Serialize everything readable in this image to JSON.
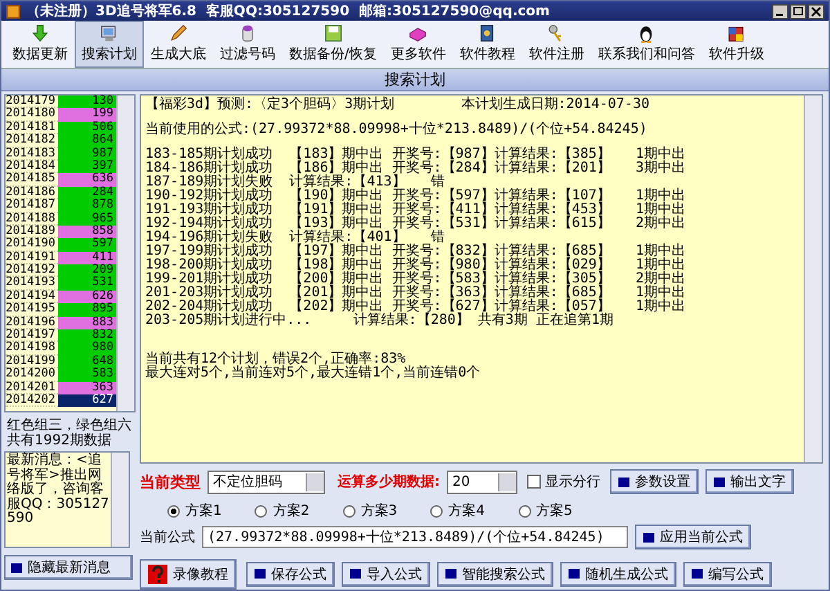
{
  "window": {
    "title": "（未注册）3D追号将军6.8  客服QQ:305127590  邮箱:305127590@qq.com"
  },
  "toolbar": [
    {
      "label": "数据更新",
      "selected": false
    },
    {
      "label": "搜索计划",
      "selected": true
    },
    {
      "label": "生成大底",
      "selected": false
    },
    {
      "label": "过滤号码",
      "selected": false
    },
    {
      "label": "数据备份/恢复",
      "selected": false
    },
    {
      "label": "更多软件",
      "selected": false
    },
    {
      "label": "软件教程",
      "selected": false
    },
    {
      "label": "软件注册",
      "selected": false
    },
    {
      "label": "联系我们和问答",
      "selected": false
    },
    {
      "label": "软件升级",
      "selected": false
    }
  ],
  "panel_title": "搜索计划",
  "history": [
    {
      "period": "2014179",
      "number": "130",
      "color": "#00cc00",
      "selected": false
    },
    {
      "period": "2014180",
      "number": "199",
      "color": "#e070e0",
      "selected": false
    },
    {
      "period": "2014181",
      "number": "506",
      "color": "#00cc00",
      "selected": false
    },
    {
      "period": "2014182",
      "number": "864",
      "color": "#00cc00",
      "selected": false
    },
    {
      "period": "2014183",
      "number": "987",
      "color": "#00cc00",
      "selected": false
    },
    {
      "period": "2014184",
      "number": "397",
      "color": "#00cc00",
      "selected": false
    },
    {
      "period": "2014185",
      "number": "636",
      "color": "#e070e0",
      "selected": false
    },
    {
      "period": "2014186",
      "number": "284",
      "color": "#00cc00",
      "selected": false
    },
    {
      "period": "2014187",
      "number": "878",
      "color": "#00cc00",
      "selected": false
    },
    {
      "period": "2014188",
      "number": "965",
      "color": "#00cc00",
      "selected": false
    },
    {
      "period": "2014189",
      "number": "858",
      "color": "#e070e0",
      "selected": false
    },
    {
      "period": "2014190",
      "number": "597",
      "color": "#00cc00",
      "selected": false
    },
    {
      "period": "2014191",
      "number": "411",
      "color": "#e070e0",
      "selected": false
    },
    {
      "period": "2014192",
      "number": "209",
      "color": "#00cc00",
      "selected": false
    },
    {
      "period": "2014193",
      "number": "531",
      "color": "#00cc00",
      "selected": false
    },
    {
      "period": "2014194",
      "number": "626",
      "color": "#e070e0",
      "selected": false
    },
    {
      "period": "2014195",
      "number": "895",
      "color": "#00cc00",
      "selected": false
    },
    {
      "period": "2014196",
      "number": "883",
      "color": "#e070e0",
      "selected": false
    },
    {
      "period": "2014197",
      "number": "832",
      "color": "#00cc00",
      "selected": false
    },
    {
      "period": "2014198",
      "number": "980",
      "color": "#00cc00",
      "selected": false
    },
    {
      "period": "2014199",
      "number": "648",
      "color": "#00cc00",
      "selected": false
    },
    {
      "period": "2014200",
      "number": "583",
      "color": "#00cc00",
      "selected": false
    },
    {
      "period": "2014201",
      "number": "363",
      "color": "#e070e0",
      "selected": false
    },
    {
      "period": "2014202",
      "number": "627",
      "selected": true
    }
  ],
  "legend": [
    "红色组三，绿色组六",
    "共有1992期数据"
  ],
  "news": "最新消息：<追号将军>推出网络版了，咨询客服QQ：305127590",
  "hide_news_button": "隐藏最新消息",
  "report": [
    [
      "【福彩3d】预测:〈定3个胆码〉3期计划        本计划生成日期:2014-07-30"
    ],
    [
      "当前使用的公式:(27.99372*88.09998+十位*213.8489)/(个位+54.84245)"
    ],
    [
      "183-185期计划成功  【183】期中出 开奖号:【987】计算结果:【385】   1期中出",
      "184-186期计划成功  【186】期中出 开奖号:【284】计算结果:【201】   3期中出",
      "187-189期计划失败  计算结果:【413】   错",
      "190-192期计划成功  【190】期中出 开奖号:【597】计算结果:【107】   1期中出",
      "191-193期计划成功  【191】期中出 开奖号:【411】计算结果:【453】   1期中出",
      "192-194期计划成功  【193】期中出 开奖号:【531】计算结果:【615】   2期中出",
      "194-196期计划失败  计算结果:【401】   错",
      "197-199期计划成功  【197】期中出 开奖号:【832】计算结果:【685】   1期中出",
      "198-200期计划成功  【198】期中出 开奖号:【980】计算结果:【029】   1期中出",
      "199-201期计划成功  【200】期中出 开奖号:【583】计算结果:【305】   2期中出",
      "201-203期计划成功  【201】期中出 开奖号:【363】计算结果:【685】   1期中出",
      "202-204期计划成功  【202】期中出 开奖号:【627】计算结果:【057】   1期中出",
      "203-205期计划进行中...     计算结果:【280】 共有3期 正在追第1期"
    ],
    [
      "当前共有12个计划，错误2个,正确率:83%",
      "最大连对5个,当前连对5个,最大连错1个,当前连错0个"
    ]
  ],
  "type_label": "当前类型",
  "type_select": {
    "value": "不定位胆码"
  },
  "periods_label": "运算多少期数据:",
  "periods_select": {
    "value": "20"
  },
  "show_rows": {
    "label": "显示分行",
    "checked": false
  },
  "top_buttons": [
    "参数设置",
    "输出文字"
  ],
  "schemes": [
    {
      "label": "方案1",
      "selected": true
    },
    {
      "label": "方案2",
      "selected": false
    },
    {
      "label": "方案3",
      "selected": false
    },
    {
      "label": "方案4",
      "selected": false
    },
    {
      "label": "方案5",
      "selected": false
    }
  ],
  "formula": {
    "label": "当前公式",
    "value": "(27.99372*88.09998+十位*213.8489)/(个位+54.84245)"
  },
  "apply_button": "应用当前公式",
  "tutorial_button": "录像教程",
  "bottom_buttons": [
    "保存公式",
    "导入公式",
    "智能搜索公式",
    "随机生成公式",
    "编写公式"
  ]
}
